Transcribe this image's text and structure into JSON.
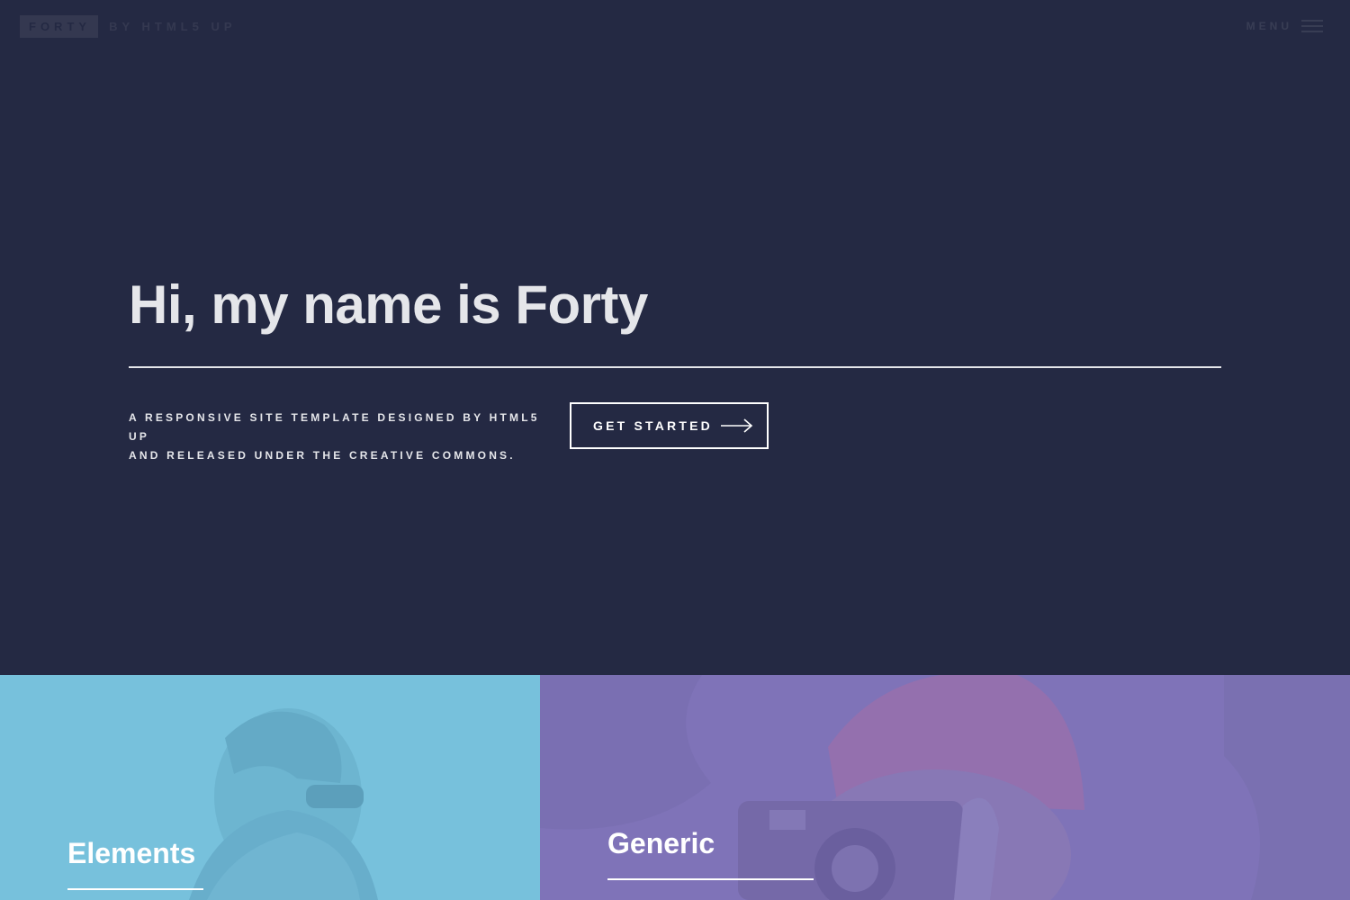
{
  "header": {
    "logo_box": "Forty",
    "logo_rest": "by HTML5 UP",
    "menu_label": "Menu",
    "menu_icon": "hamburger-icon"
  },
  "banner": {
    "title": "Hi, my name is Forty",
    "subtitle_line1": "A responsive site template designed by HTML5 UP",
    "subtitle_line2": "and released under the Creative Commons.",
    "button_label": "Get Started",
    "button_icon": "arrow-right-icon"
  },
  "tiles": [
    {
      "title": "Elements",
      "color": "#77c1dc"
    },
    {
      "title": "Generic",
      "color": "#7f73b8"
    }
  ],
  "colors": {
    "background": "#242943",
    "text": "#e5e6ea",
    "accent_blue": "#77c1dc",
    "accent_purple": "#7f73b8"
  }
}
